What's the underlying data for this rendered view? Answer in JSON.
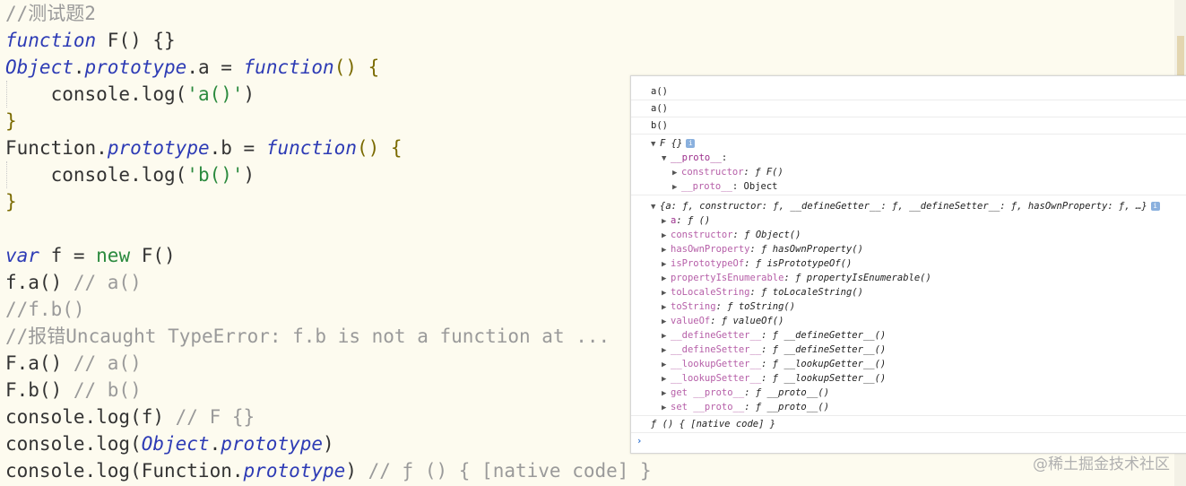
{
  "editor": {
    "lines": [
      "//测试题2",
      "function F() {}",
      "Object.prototype.a = function() {",
      "    console.log('a()')",
      "}",
      "Function.prototype.b = function() {",
      "    console.log('b()')",
      "}",
      "",
      "var f = new F()",
      "f.a() // a()",
      "//f.b()",
      "//报错Uncaught TypeError: f.b is not a function at ...",
      "F.a() // a()",
      "F.b() // b()",
      "console.log(f) // F {}",
      "console.log(Object.prototype)",
      "console.log(Function.prototype) // ƒ () { [native code] }"
    ],
    "tokens": {
      "l0_comment": "//测试题2",
      "l1_kw": "function",
      "l1_rest": " F() {}",
      "l2_cls": "Object",
      "l2_dot": ".",
      "l2_proto": "prototype",
      "l2_mid": ".a = ",
      "l2_kw": "function",
      "l2_par": "() {",
      "l3_pre": "    console.log(",
      "l3_str": "'a()'",
      "l3_end": ")",
      "l4": "}",
      "l5_cls": "Function",
      "l5_dot": ".",
      "l5_proto": "prototype",
      "l5_mid": ".b = ",
      "l5_kw": "function",
      "l5_par": "() {",
      "l6_pre": "    console.log(",
      "l6_str": "'b()'",
      "l6_end": ")",
      "l7": "}",
      "l9_kw": "var",
      "l9_mid": " f = ",
      "l9_new": "new",
      "l9_rest": " F()",
      "l10_code": "f.a() ",
      "l10_cm": "// a()",
      "l11_cm": "//f.b()",
      "l12_cm": "//报错Uncaught TypeError: f.b is not a function at ...",
      "l13_code": "F.a() ",
      "l13_cm": "// a()",
      "l14_code": "F.b() ",
      "l14_cm": "// b()",
      "l15_code": "console.log(f) ",
      "l15_cm": "// F {}",
      "l16_pre": "console.log(",
      "l16_cls": "Object",
      "l16_dot": ".",
      "l16_proto": "prototype",
      "l16_end": ")",
      "l17_pre": "console.log(",
      "l17_cls": "Function",
      "l17_dot": ".",
      "l17_proto": "prototype",
      "l17_end": ") ",
      "l17_cm": "// ƒ () { [native code] }"
    }
  },
  "console": {
    "log_a1": "a()",
    "log_a2": "a()",
    "log_b": "b()",
    "f_obj": {
      "title": "F {}",
      "proto_label": "__proto__",
      "proto_colon": ":",
      "constructor_key": "constructor",
      "constructor_val": ": ƒ F()",
      "proto2_key": "__proto__",
      "proto2_val": ": Object"
    },
    "object_proto": {
      "title": "{a: ƒ, constructor: ƒ, __defineGetter__: ƒ, __defineSetter__: ƒ, hasOwnProperty: ƒ, …}",
      "entries": [
        {
          "key": "a",
          "val": ": ƒ ()"
        },
        {
          "key": "constructor",
          "val": ": ƒ Object()"
        },
        {
          "key": "hasOwnProperty",
          "val": ": ƒ hasOwnProperty()"
        },
        {
          "key": "isPrototypeOf",
          "val": ": ƒ isPrototypeOf()"
        },
        {
          "key": "propertyIsEnumerable",
          "val": ": ƒ propertyIsEnumerable()"
        },
        {
          "key": "toLocaleString",
          "val": ": ƒ toLocaleString()"
        },
        {
          "key": "toString",
          "val": ": ƒ toString()"
        },
        {
          "key": "valueOf",
          "val": ": ƒ valueOf()"
        },
        {
          "key": "__defineGetter__",
          "val": ": ƒ __defineGetter__()"
        },
        {
          "key": "__defineSetter__",
          "val": ": ƒ __defineSetter__()"
        },
        {
          "key": "__lookupGetter__",
          "val": ": ƒ __lookupGetter__()"
        },
        {
          "key": "__lookupSetter__",
          "val": ": ƒ __lookupSetter__()"
        },
        {
          "key": "get __proto__",
          "val": ": ƒ __proto__()"
        },
        {
          "key": "set __proto__",
          "val": ": ƒ __proto__()"
        }
      ]
    },
    "native_code": "ƒ () { [native code] }",
    "prompt": "›"
  },
  "icons": {
    "info": "info-icon",
    "expand": "triangle-right-icon",
    "collapse": "triangle-down-icon"
  },
  "watermark": "@稀土掘金技术社区"
}
